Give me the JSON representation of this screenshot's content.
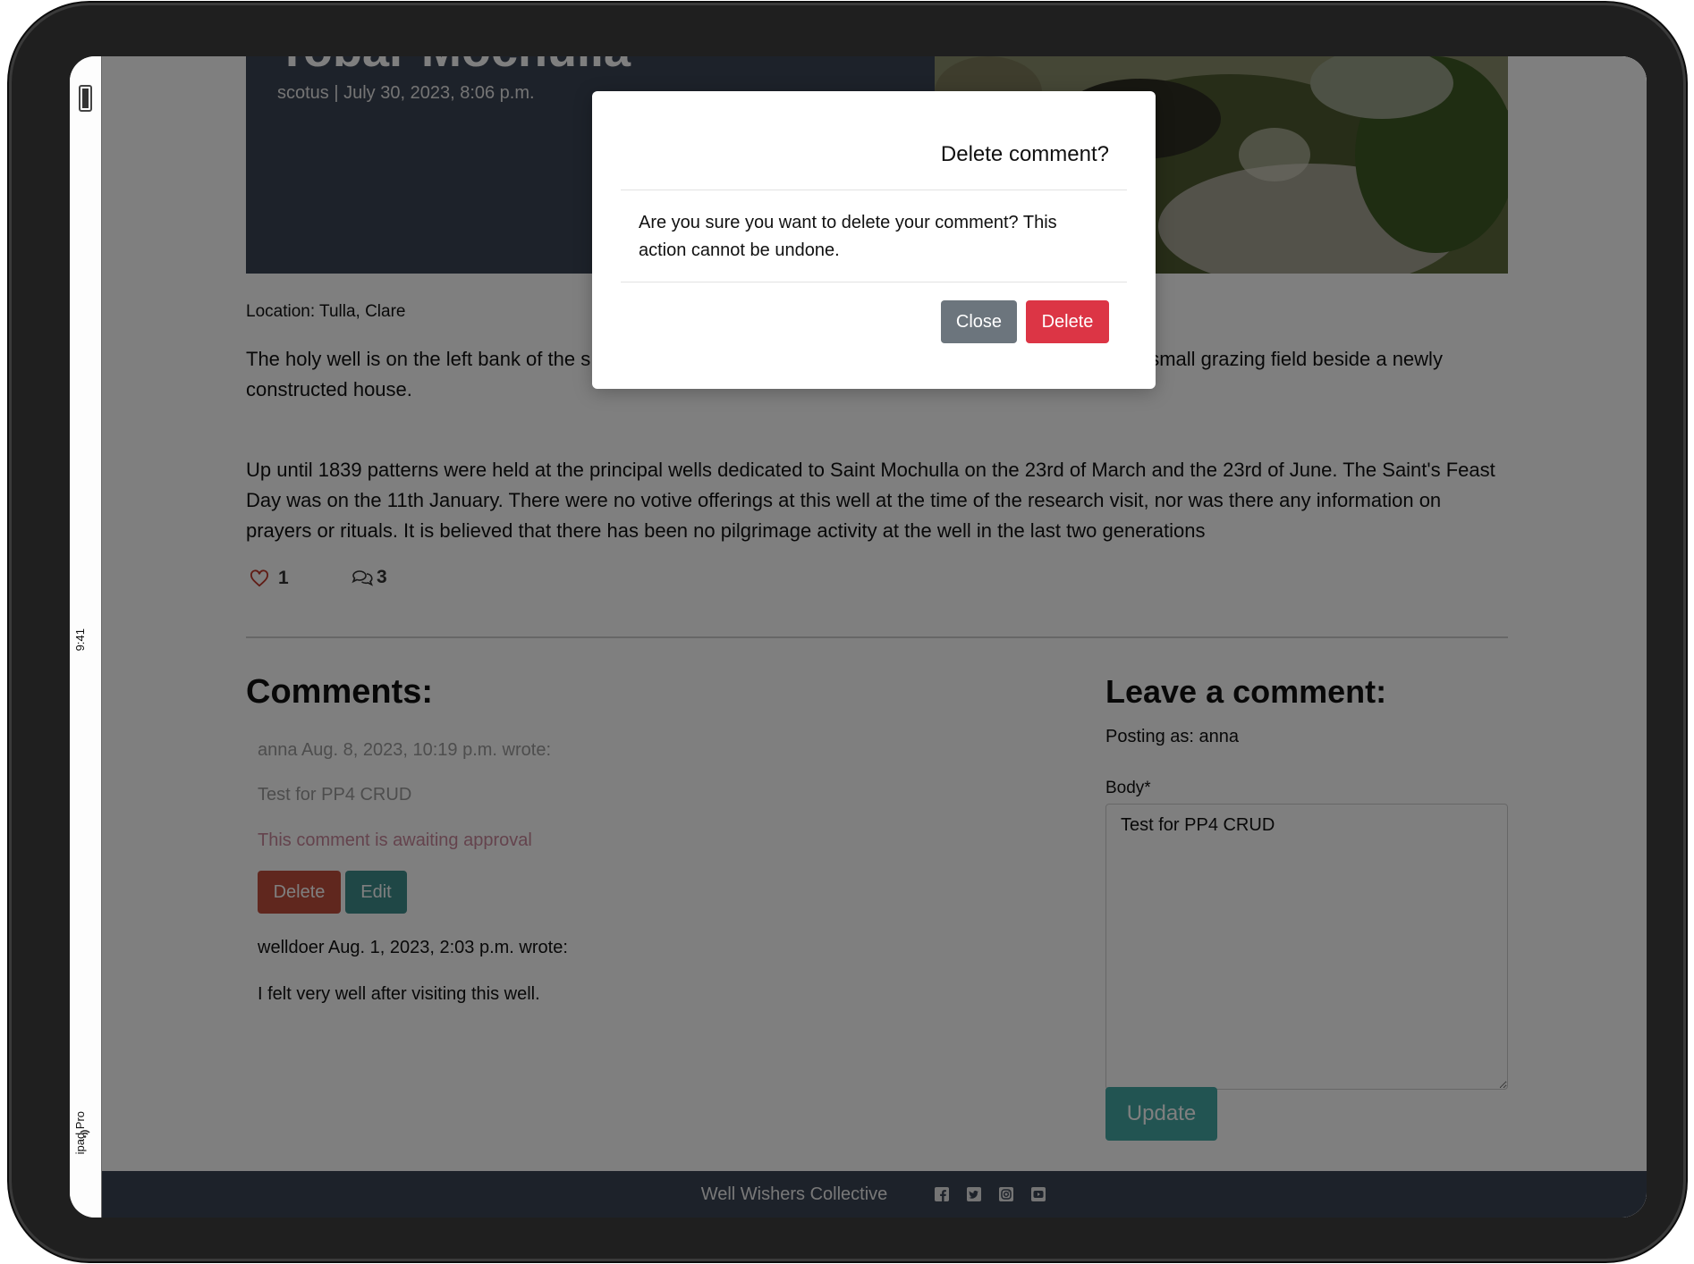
{
  "device": {
    "time": "9:41",
    "name": "ipad Pro"
  },
  "post": {
    "title": "Tobar Mochulla",
    "meta": "scotus | July 30, 2023, 8:06 p.m.",
    "location": "Location: Tulla, Clare",
    "paragraph1_start": "The holy well is on the left bank of the s",
    "paragraph1_end": "small grazing field beside a newly constructed house.",
    "paragraph2": "Up until 1839 patterns were held at the principal wells dedicated to Saint Mochulla on the 23rd of March and the 23rd of June. The Saint's Feast Day was on the 11th January. There were no votive offerings at this well at the time of the research visit, nor was there any information on prayers or rituals. It is believed that there has been no pilgrimage activity at the well in the last two generations",
    "likes": "1",
    "comment_count": "3"
  },
  "comments": {
    "heading": "Comments:",
    "items": [
      {
        "meta": "anna Aug. 8, 2023, 10:19 p.m. wrote:",
        "body": "Test for PP4 CRUD",
        "awaiting": "This comment is awaiting approval",
        "delete_label": "Delete",
        "edit_label": "Edit"
      },
      {
        "meta": "welldoer Aug. 1, 2023, 2:03 p.m. wrote:",
        "body": "I felt very well after visiting this well."
      }
    ]
  },
  "form": {
    "heading": "Leave a comment:",
    "posting_as": "Posting as: anna",
    "body_label": "Body*",
    "body_value": "Test for PP4 CRUD",
    "submit_label": "Update"
  },
  "footer": {
    "brand": "Well Wishers Collective",
    "socials": [
      "facebook-icon",
      "twitter-icon",
      "instagram-icon",
      "youtube-icon"
    ]
  },
  "modal": {
    "title": "Delete comment?",
    "body": "Are you sure you want to delete your comment? This action cannot be undone.",
    "close_label": "Close",
    "delete_label": "Delete"
  },
  "colors": {
    "hero_bg": "#3b4454",
    "comment_delete": "#c14f3c",
    "comment_edit": "#3f8f8c",
    "update": "#45a8a5",
    "modal_close": "#6c757d",
    "modal_delete": "#dc3545"
  }
}
